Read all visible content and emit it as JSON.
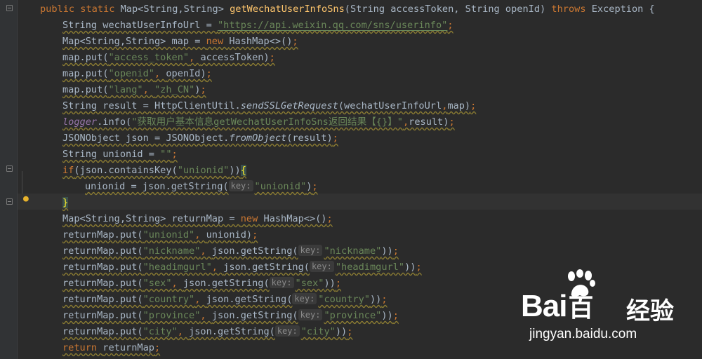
{
  "editor": {
    "lines": [
      [
        [
          "kw",
          "public static "
        ],
        [
          "txt",
          "Map<String,String> "
        ],
        [
          "fn",
          "getWechatUserInfoSns"
        ],
        [
          "txt",
          "(String accessToken, String openId) "
        ],
        [
          "kw",
          "throws "
        ],
        [
          "txt",
          "Exception {"
        ]
      ],
      [
        [
          "txt",
          "String wechatUserInfoUrl = "
        ],
        [
          "link",
          "\"https://api.weixin.qq.com/sns/userinfo\""
        ],
        [
          "kw",
          ";"
        ]
      ],
      [
        [
          "txt",
          "Map<String,String> map = "
        ],
        [
          "kw",
          "new "
        ],
        [
          "txt",
          "HashMap<>()"
        ],
        [
          "kw",
          ";"
        ]
      ],
      [
        [
          "txt",
          "map.put("
        ],
        [
          "str",
          "\"access_token\""
        ],
        [
          "kw",
          ", "
        ],
        [
          "txt",
          "accessToken)"
        ],
        [
          "kw",
          ";"
        ]
      ],
      [
        [
          "txt",
          "map.put("
        ],
        [
          "str",
          "\"openid\""
        ],
        [
          "kw",
          ", "
        ],
        [
          "txt",
          "openId)"
        ],
        [
          "kw",
          ";"
        ]
      ],
      [
        [
          "txt",
          "map.put("
        ],
        [
          "str",
          "\"lang\""
        ],
        [
          "kw",
          ", "
        ],
        [
          "str",
          "\"zh_CN\""
        ],
        [
          "txt",
          ")"
        ],
        [
          "kw",
          ";"
        ]
      ],
      [
        [
          "txt",
          "String result = HttpClientUtil."
        ],
        [
          "static",
          "sendSSLGetRequest"
        ],
        [
          "txt",
          "(wechatUserInfoUrl"
        ],
        [
          "kw",
          ","
        ],
        [
          "txt",
          "map)"
        ],
        [
          "kw",
          ";"
        ]
      ],
      [
        [
          "field",
          "logger"
        ],
        [
          "txt",
          ".info("
        ],
        [
          "str",
          "\"获取用户基本信息getWechatUserInfoSns返回结果【{}】\""
        ],
        [
          "kw",
          ","
        ],
        [
          "txt",
          "result)"
        ],
        [
          "kw",
          ";"
        ]
      ],
      [
        [
          "txt",
          "JSONObject json = JSONObject."
        ],
        [
          "static",
          "fromObject"
        ],
        [
          "txt",
          "(result)"
        ],
        [
          "kw",
          ";"
        ]
      ],
      [
        [
          "txt",
          "String unionid = "
        ],
        [
          "str",
          "\"\""
        ],
        [
          "kw",
          ";"
        ]
      ],
      [
        [
          "kw",
          "if"
        ],
        [
          "txt",
          "(json.containsKey("
        ],
        [
          "str",
          "\"unionid\""
        ],
        [
          "txt",
          "))"
        ],
        [
          "brace",
          "{"
        ]
      ],
      [
        [
          "txt",
          "unionid = json.getString("
        ],
        [
          "hint",
          "key:"
        ],
        [
          "str",
          "\"unionid\""
        ],
        [
          "txt",
          ")"
        ],
        [
          "kw",
          ";"
        ]
      ],
      [
        [
          "brace",
          "}"
        ]
      ],
      [
        [
          "txt",
          "Map<String,String> returnMap = "
        ],
        [
          "kw",
          "new "
        ],
        [
          "txt",
          "HashMap<>()"
        ],
        [
          "kw",
          ";"
        ]
      ],
      [
        [
          "txt",
          "returnMap.put("
        ],
        [
          "str",
          "\"unionid\""
        ],
        [
          "kw",
          ", "
        ],
        [
          "txt",
          "unionid)"
        ],
        [
          "kw",
          ";"
        ]
      ],
      [
        [
          "txt",
          "returnMap.put("
        ],
        [
          "str",
          "\"nickname\""
        ],
        [
          "kw",
          ", "
        ],
        [
          "txt",
          "json.getString("
        ],
        [
          "hint",
          "key:"
        ],
        [
          "str",
          "\"nickname\""
        ],
        [
          "txt",
          "))"
        ],
        [
          "kw",
          ";"
        ]
      ],
      [
        [
          "txt",
          "returnMap.put("
        ],
        [
          "str",
          "\"headimgurl\""
        ],
        [
          "kw",
          ", "
        ],
        [
          "txt",
          "json.getString("
        ],
        [
          "hint",
          "key:"
        ],
        [
          "str",
          "\"headimgurl\""
        ],
        [
          "txt",
          "))"
        ],
        [
          "kw",
          ";"
        ]
      ],
      [
        [
          "txt",
          "returnMap.put("
        ],
        [
          "str",
          "\"sex\""
        ],
        [
          "kw",
          ", "
        ],
        [
          "txt",
          "json.getString("
        ],
        [
          "hint",
          "key:"
        ],
        [
          "str",
          "\"sex\""
        ],
        [
          "txt",
          "))"
        ],
        [
          "kw",
          ";"
        ]
      ],
      [
        [
          "txt",
          "returnMap.put("
        ],
        [
          "str",
          "\"country\""
        ],
        [
          "kw",
          ", "
        ],
        [
          "txt",
          "json.getString("
        ],
        [
          "hint",
          "key:"
        ],
        [
          "str",
          "\"country\""
        ],
        [
          "txt",
          "))"
        ],
        [
          "kw",
          ";"
        ]
      ],
      [
        [
          "txt",
          "returnMap.put("
        ],
        [
          "str",
          "\"province\""
        ],
        [
          "kw",
          ", "
        ],
        [
          "txt",
          "json.getString("
        ],
        [
          "hint",
          "key:"
        ],
        [
          "str",
          "\"province\""
        ],
        [
          "txt",
          "))"
        ],
        [
          "kw",
          ";"
        ]
      ],
      [
        [
          "txt",
          "returnMap.put("
        ],
        [
          "str",
          "\"city\""
        ],
        [
          "kw",
          ", "
        ],
        [
          "txt",
          "json.getString("
        ],
        [
          "hint",
          "key:"
        ],
        [
          "str",
          "\"city\""
        ],
        [
          "txt",
          "))"
        ],
        [
          "kw",
          ";"
        ]
      ],
      [
        [
          "kw",
          "return "
        ],
        [
          "txt",
          "returnMap"
        ],
        [
          "kw",
          ";"
        ]
      ]
    ],
    "indents": [
      0,
      1,
      1,
      1,
      1,
      1,
      1,
      1,
      1,
      1,
      1,
      2,
      1,
      1,
      1,
      1,
      1,
      1,
      1,
      1,
      1,
      1
    ],
    "squiggly": [
      false,
      true,
      true,
      true,
      true,
      true,
      true,
      true,
      true,
      true,
      true,
      true,
      true,
      true,
      true,
      true,
      true,
      true,
      true,
      true,
      true,
      true
    ],
    "icons": {
      "fold": "fold-marker-icon",
      "intention": "lightbulb-icon"
    }
  },
  "watermark": {
    "brand": "Bai",
    "brand_tail": "百",
    "site_cn": "经验",
    "url": "jingyan.baidu.com"
  },
  "colors": {
    "background": "#2b2b2b",
    "keyword": "#cc7832",
    "string": "#6a8759",
    "method_decl": "#ffc66d",
    "field": "#9876aa",
    "text": "#a9b7c6"
  }
}
